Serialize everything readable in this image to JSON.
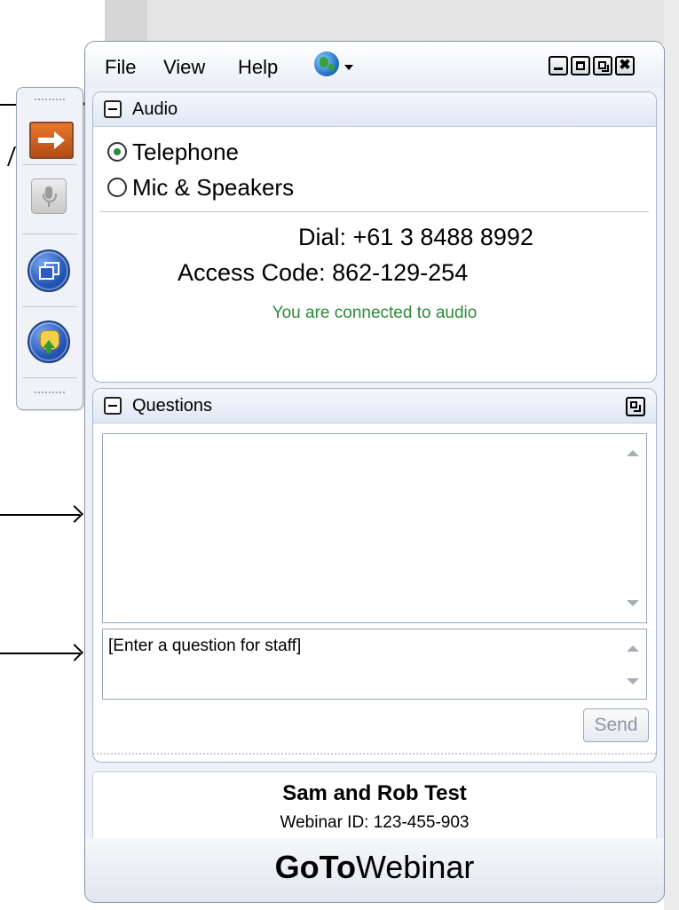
{
  "menu": {
    "file": "File",
    "view": "View",
    "help": "Help",
    "language_icon": "globe-icon"
  },
  "window_controls": [
    "minimize",
    "maximize",
    "pop-out",
    "close"
  ],
  "window_close_glyph": "✖",
  "audio": {
    "title": "Audio",
    "options": [
      {
        "label": "Telephone",
        "selected": true
      },
      {
        "label": "Mic & Speakers",
        "selected": false
      }
    ],
    "dial_line": "Dial: +61 3 8488 8992",
    "access_line": "Access Code: 862-129-254",
    "status": "You are connected to audio"
  },
  "questions": {
    "title": "Questions",
    "input_placeholder": "[Enter a question for staff]",
    "send_label": "Send"
  },
  "session": {
    "title": "Sam and Rob Test",
    "webinar_id": "Webinar ID: 123-455-903"
  },
  "brand": {
    "part1": "GoTo",
    "part2": "Webinar"
  },
  "toolbar": {
    "icons": [
      "arrow-icon",
      "microphone-icon",
      "windows-icon",
      "raise-hand-icon"
    ]
  },
  "colors": {
    "accent_orange": "#d1621f",
    "status_green": "#2e8b3a",
    "button_blue": "#2456b8"
  }
}
